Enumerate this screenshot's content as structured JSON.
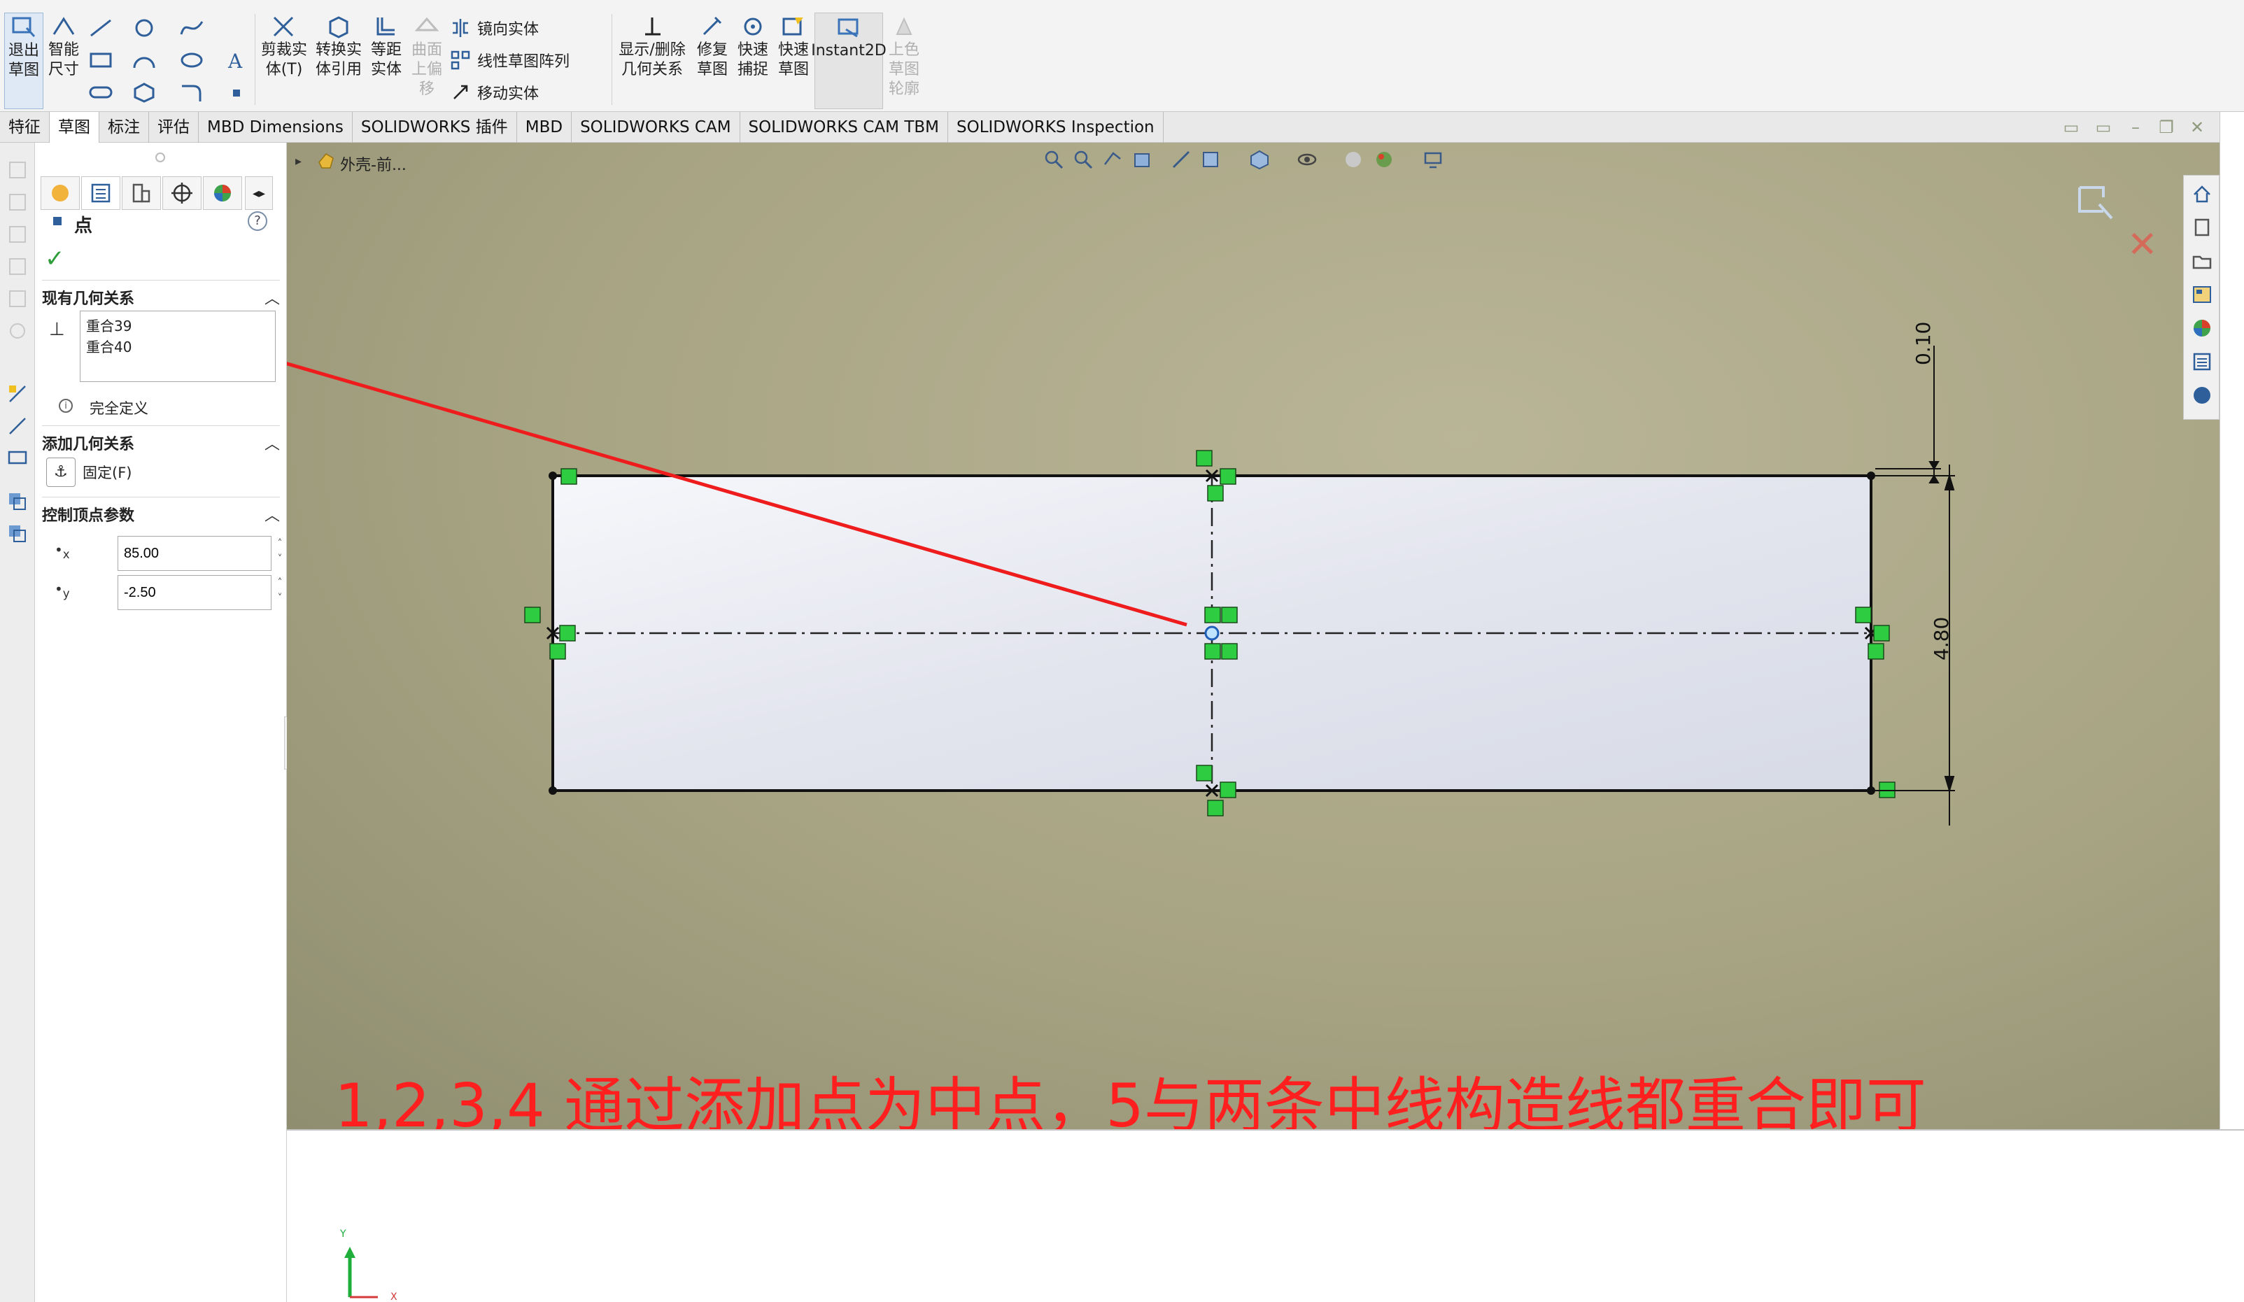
{
  "ribbon": {
    "exit_sketch": "退出\n草图",
    "smart_dim": "智能\n尺寸",
    "trim": "剪裁实\n体(T)",
    "convert": "转换实\n体引用",
    "offset": "等距\n实体",
    "surface_offset": "曲面\n上偏\n移",
    "mirror": "镜向实体",
    "linear_pattern": "线性草图阵列",
    "move": "移动实体",
    "show_delete": "显示/删除\n几何关系",
    "repair": "修复\n草图",
    "quick_snap": "快速\n捕捉",
    "rapid_sketch": "快速\n草图",
    "instant2d": "Instant2D",
    "shaded": "上色\n草图\n轮廓"
  },
  "tabs": [
    "特征",
    "草图",
    "标注",
    "评估",
    "MBD Dimensions",
    "SOLIDWORKS 插件",
    "MBD",
    "SOLIDWORKS CAM",
    "SOLIDWORKS CAM TBM",
    "SOLIDWORKS Inspection"
  ],
  "active_tab": "草图",
  "property_manager": {
    "title": "点",
    "help": "?",
    "existing_relations_header": "现有几何关系",
    "relations": [
      "重合39",
      "重合40"
    ],
    "status": "完全定义",
    "add_relations_header": "添加几何关系",
    "fix_label": "固定(F)",
    "point_params_header": "控制顶点参数",
    "x_value": "85.00",
    "y_value": "-2.50"
  },
  "viewport": {
    "breadcrumb": "外壳-前...",
    "dim_top": "0.10",
    "dim_right": "4.80",
    "annotation": "1,2,3,4 通过添加点为中点，5与两条中线构造线都重合即可",
    "triad_y": "Y",
    "triad_x": "X"
  },
  "colors": {
    "viewport_bg": "#a7a483",
    "annotation": "#ff1f1f",
    "relation_icon": "#2ecc40",
    "sketch_line": "#111111"
  }
}
